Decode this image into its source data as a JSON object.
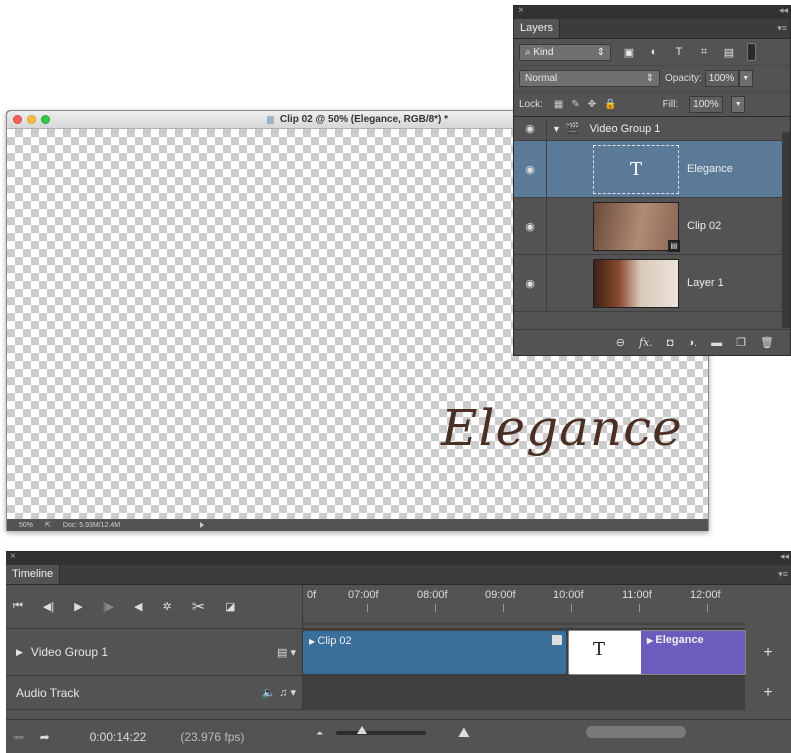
{
  "document": {
    "title": "Clip 02 @ 50% (Elegance, RGB/8*) *",
    "canvas_text": "Elegance",
    "status": {
      "zoom": "50%",
      "doc_info": "Doc: 5.93M/12.4M"
    }
  },
  "layers_panel": {
    "close": "×",
    "tab": "Layers",
    "filter_kind": "Kind",
    "blend_mode": "Normal",
    "opacity_label": "Opacity:",
    "opacity_value": "100%",
    "lock_label": "Lock:",
    "fill_label": "Fill:",
    "fill_value": "100%",
    "group_name": "Video Group 1",
    "layers": [
      {
        "name": "Elegance",
        "thumb": "T",
        "selected": true
      },
      {
        "name": "Clip 02",
        "selected": false
      },
      {
        "name": "Layer 1",
        "selected": false
      }
    ]
  },
  "timeline": {
    "close": "×",
    "tab": "Timeline",
    "ruler_labels": [
      "0f",
      "07:00f",
      "08:00f",
      "09:00f",
      "10:00f",
      "11:00f",
      "12:00f"
    ],
    "tracks": {
      "video_group": "Video Group 1",
      "audio": "Audio Track"
    },
    "clips": {
      "clip02": "Clip 02",
      "text_thumb": "T",
      "elegance": "Elegance"
    },
    "timecode": "0:00:14:22",
    "fps": "(23.976 fps)"
  }
}
